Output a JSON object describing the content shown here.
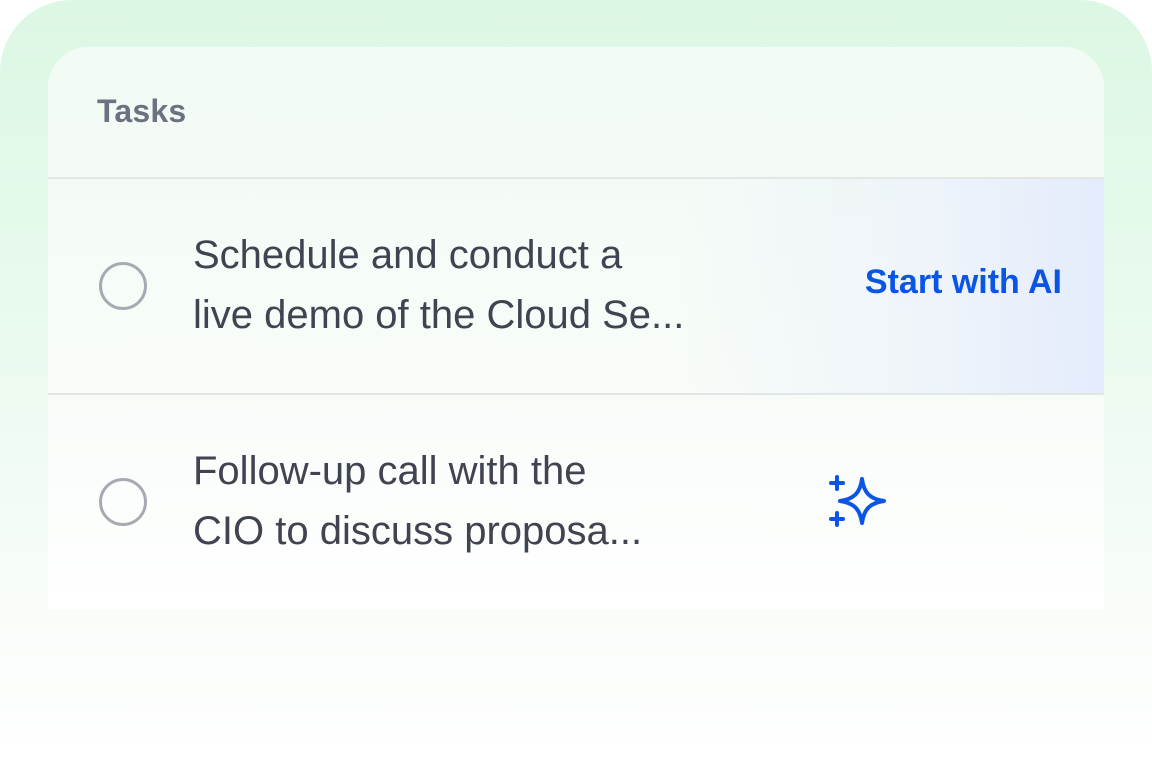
{
  "tasks_panel": {
    "title": "Tasks",
    "tasks": [
      {
        "line1": "Schedule and conduct a",
        "line2": "live demo of the Cloud Se...",
        "action_label": "Start with AI",
        "completed": false
      },
      {
        "line1": "Follow-up call with the",
        "line2": "CIO to discuss proposa...",
        "action_icon": "sparkle-icon",
        "completed": false
      }
    ]
  },
  "colors": {
    "accent": "#0a54e6",
    "title_text": "#6b7280",
    "task_text": "#3f4450",
    "background_top": "#dcf7e4"
  }
}
